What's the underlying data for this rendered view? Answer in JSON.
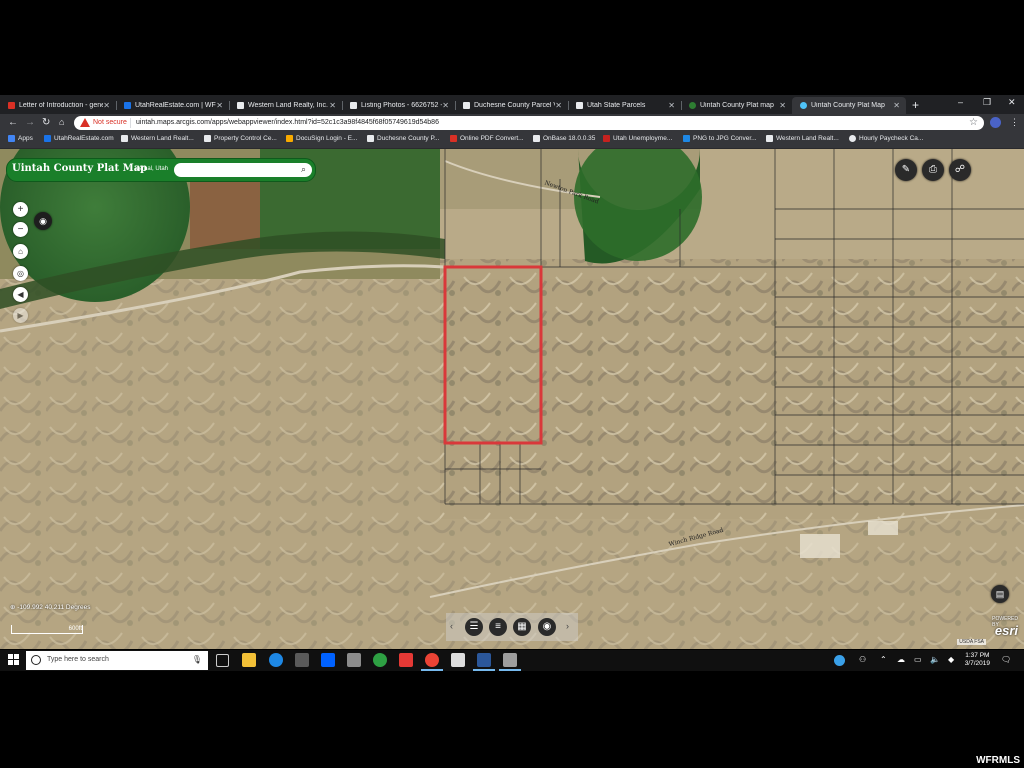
{
  "browser": {
    "tabs": [
      {
        "title": "Letter of Introduction - gene",
        "icon": "gmail-icon",
        "color": "#d93025"
      },
      {
        "title": "UtahRealEstate.com | WFR",
        "icon": "ure-icon",
        "color": "#1a73e8"
      },
      {
        "title": "Western Land Realty, Inc. A",
        "icon": "page-icon",
        "color": "#e8eaed"
      },
      {
        "title": "Listing Photos - 6626752 - ",
        "icon": "page-icon",
        "color": "#e8eaed"
      },
      {
        "title": "Duchesne County Parcel Vie",
        "icon": "page-icon",
        "color": "#e8eaed"
      },
      {
        "title": "Utah State Parcels",
        "icon": "page-icon",
        "color": "#e8eaed"
      },
      {
        "title": "Uintah County Plat map",
        "icon": "globe-icon",
        "color": "#2e7d32"
      },
      {
        "title": "Uintah County Plat Map",
        "icon": "arcgis-icon",
        "color": "#4fc3f7"
      }
    ],
    "active_tab": 7,
    "new_tab_label": "+",
    "window_controls": [
      "–",
      "❐",
      "✕"
    ],
    "security_label": "Not secure",
    "url": "uintah.maps.arcgis.com/apps/webappviewer/index.html?id=52c1c3a98f4845f68f05749619d54b86",
    "bookmarks": [
      {
        "label": "Apps",
        "color": "#4285f4"
      },
      {
        "label": "UtahRealEstate.com",
        "color": "#1a73e8"
      },
      {
        "label": "Western Land Realt...",
        "color": "#e8eaed"
      },
      {
        "label": "Property Control Ce...",
        "color": "#e8eaed"
      },
      {
        "label": "DocuSign Login - E...",
        "color": "#f9ab00"
      },
      {
        "label": "Duchesne County P...",
        "color": "#e8eaed"
      },
      {
        "label": "Online PDF Convert...",
        "color": "#d93025"
      },
      {
        "label": "OnBase 18.0.0.35",
        "color": "#e8eaed"
      },
      {
        "label": "Utah Unemployme...",
        "color": "#c5221f"
      },
      {
        "label": "PNG to JPG Conver...",
        "color": "#1e88e5"
      },
      {
        "label": "Western Land Realt...",
        "color": "#e8eaed"
      },
      {
        "label": "Hourly Paycheck Ca...",
        "color": "#e8eaed"
      }
    ]
  },
  "map": {
    "title": "Uintah County Plat Map",
    "subtitle": "Vernal, Utah",
    "search_placeholder": "",
    "coordinates": "-109.992 40.211 Degrees",
    "scale_label": "600ft",
    "road_label_1": "Winch Ridge Road",
    "road_label_2": "Newton Park Road",
    "attribution": "USDA FSA",
    "powered_by": "POWERED BY",
    "logo": "esri",
    "colors": {
      "header_green": "#1a7f2a",
      "parcel_highlight": "#d9383a"
    }
  },
  "taskbar": {
    "search_placeholder": "Type here to search",
    "time": "1:37 PM",
    "date": "3/7/2019"
  },
  "watermark": "WFRMLS"
}
